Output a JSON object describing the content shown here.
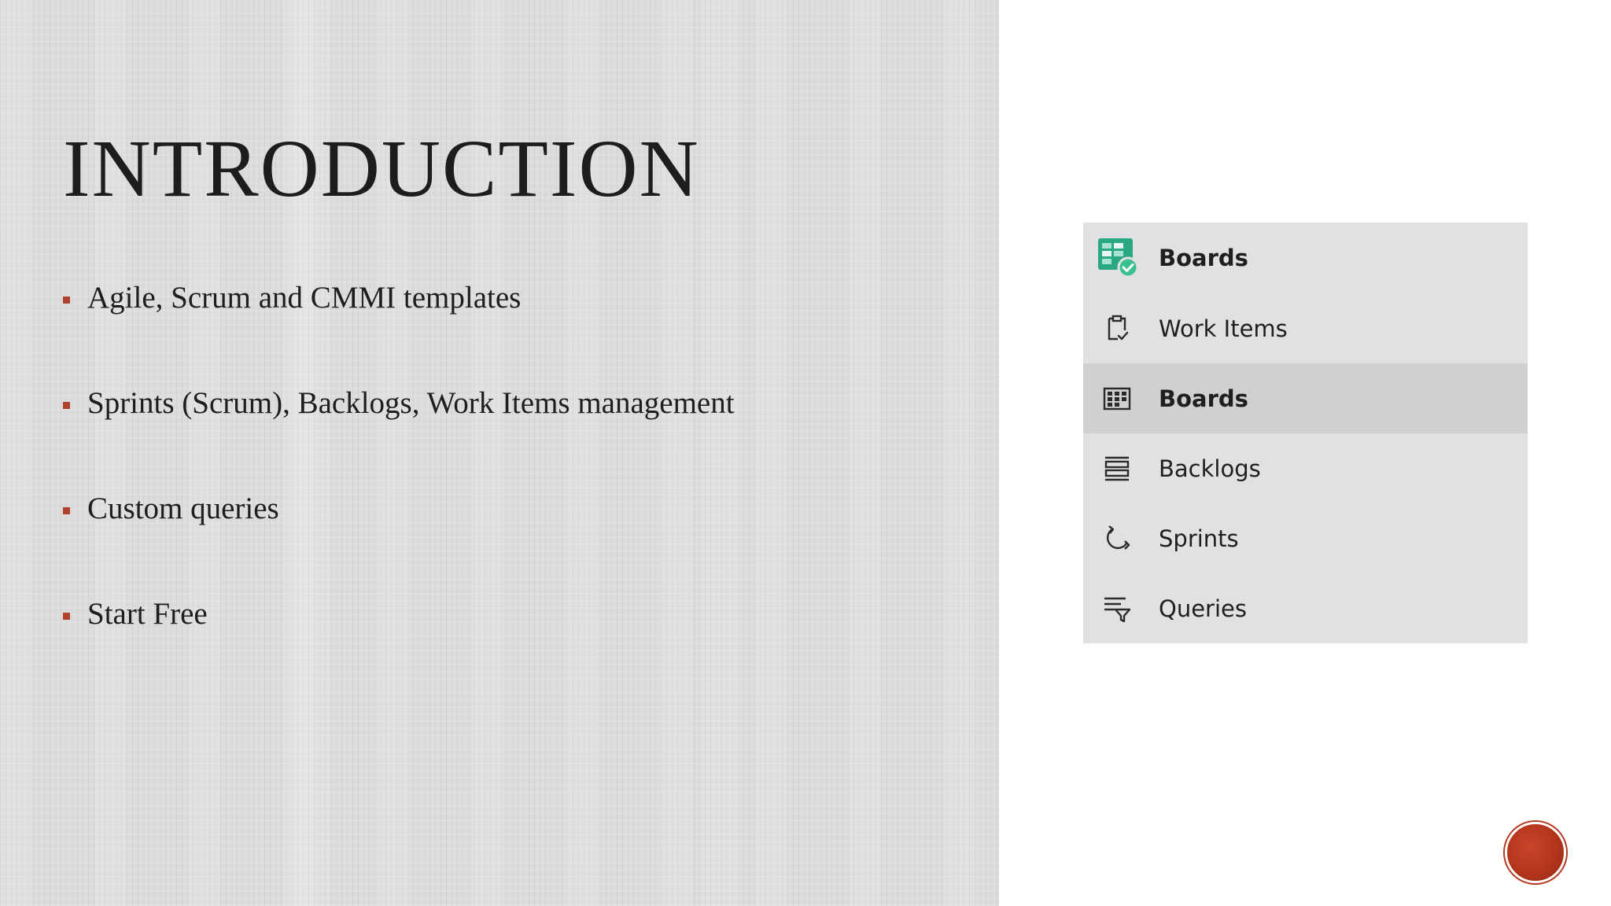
{
  "slide": {
    "title": "INTRODUCTION",
    "bullets": [
      "Agile, Scrum and CMMI templates",
      "Sprints (Scrum), Backlogs, Work Items management",
      "Custom queries",
      "Start Free"
    ],
    "bullet_color": "#b0412b"
  },
  "nav": {
    "header": {
      "label": "Boards",
      "icon": "boards-app-icon",
      "accent": "#2aa884"
    },
    "items": [
      {
        "label": "Work Items",
        "icon": "work-items-icon",
        "selected": false
      },
      {
        "label": "Boards",
        "icon": "boards-grid-icon",
        "selected": true
      },
      {
        "label": "Backlogs",
        "icon": "backlogs-icon",
        "selected": false
      },
      {
        "label": "Sprints",
        "icon": "sprints-icon",
        "selected": false
      },
      {
        "label": "Queries",
        "icon": "queries-icon",
        "selected": false
      }
    ]
  },
  "corner_badge_color": "#b3351c"
}
